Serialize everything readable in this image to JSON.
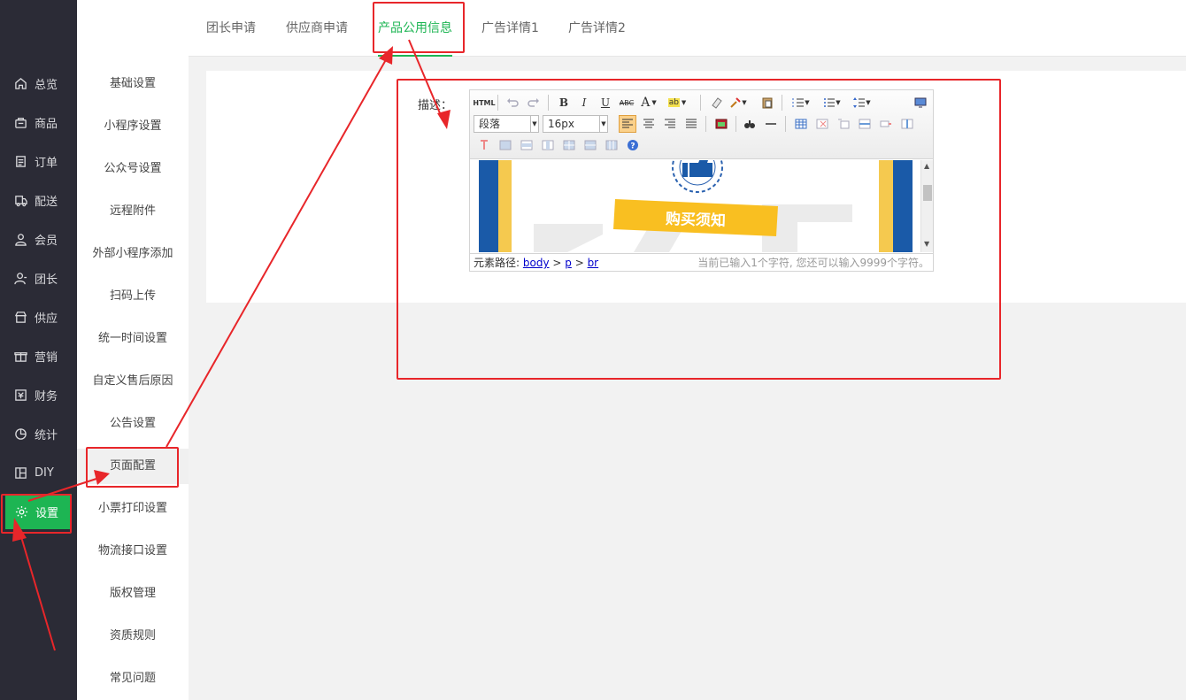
{
  "sidebar": {
    "items": [
      {
        "label": "总览",
        "icon": "home-icon"
      },
      {
        "label": "商品",
        "icon": "goods-icon"
      },
      {
        "label": "订单",
        "icon": "order-icon"
      },
      {
        "label": "配送",
        "icon": "delivery-icon"
      },
      {
        "label": "会员",
        "icon": "member-icon"
      },
      {
        "label": "团长",
        "icon": "leader-icon"
      },
      {
        "label": "供应",
        "icon": "supply-icon"
      },
      {
        "label": "营销",
        "icon": "gift-icon"
      },
      {
        "label": "财务",
        "icon": "finance-icon"
      },
      {
        "label": "统计",
        "icon": "chart-pie-icon"
      },
      {
        "label": "DIY",
        "icon": "layout-icon"
      },
      {
        "label": "设置",
        "icon": "gear-icon"
      }
    ],
    "active_index": 11
  },
  "submenu": {
    "items": [
      "基础设置",
      "小程序设置",
      "公众号设置",
      "远程附件",
      "外部小程序添加",
      "扫码上传",
      "统一时间设置",
      "自定义售后原因",
      "公告设置",
      "页面配置",
      "小票打印设置",
      "物流接口设置",
      "版权管理",
      "资质规则",
      "常见问题"
    ],
    "active_index": 9
  },
  "tabs": {
    "items": [
      "团长申请",
      "供应商申请",
      "产品公用信息",
      "广告详情1",
      "广告详情2"
    ],
    "active_index": 2
  },
  "form": {
    "desc_label": "描述："
  },
  "editor": {
    "paragraph_select": "段落",
    "fontsize_select": "16px",
    "html_button": "HTML",
    "content_banner": "购买须知",
    "status_path_label": "元素路径:",
    "status_path": [
      "body",
      "p",
      "br"
    ],
    "status_count": "当前已输入1个字符, 您还可以输入9999个字符。"
  },
  "colors": {
    "accent": "#1db553",
    "sidebar_bg": "#2b2b36",
    "annotation_red": "#e8262a",
    "banner_yellow": "#f9bf21",
    "banner_blue": "#1a5aa8"
  }
}
